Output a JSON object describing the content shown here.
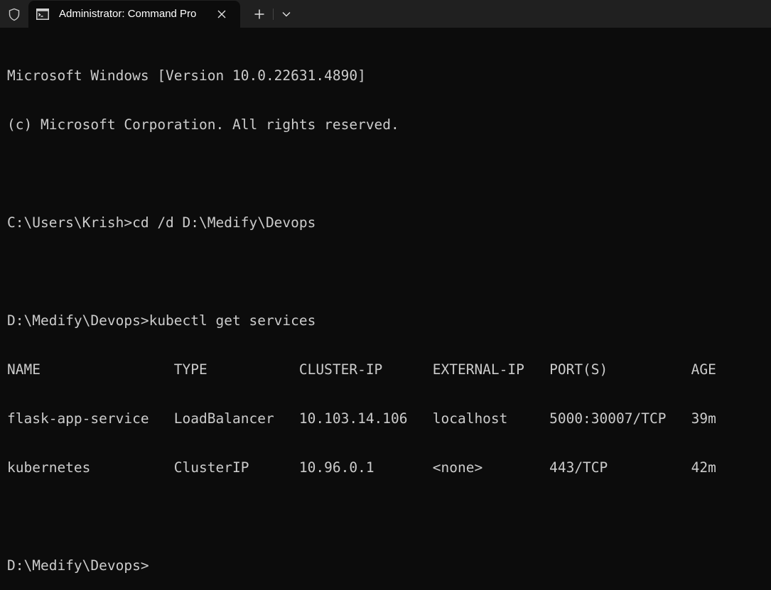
{
  "window": {
    "tab_title": "Administrator: Command Pro",
    "icons": {
      "shield": "shield-icon",
      "tab": "terminal-icon",
      "close": "close-icon",
      "new_tab": "plus-icon",
      "dropdown": "chevron-down-icon"
    }
  },
  "console": {
    "lines": [
      "Microsoft Windows [Version 10.0.22631.4890]",
      "(c) Microsoft Corporation. All rights reserved.",
      "",
      "C:\\Users\\Krish>cd /d D:\\Medify\\Devops",
      "",
      "D:\\Medify\\Devops>kubectl get services",
      "NAME                TYPE           CLUSTER-IP      EXTERNAL-IP   PORT(S)          AGE",
      "flask-app-service   LoadBalancer   10.103.14.106   localhost     5000:30007/TCP   39m",
      "kubernetes          ClusterIP      10.96.0.1       <none>        443/TCP          42m",
      "",
      "D:\\Medify\\Devops>"
    ]
  },
  "colors": {
    "background": "#0c0c0c",
    "titlebar": "#202020",
    "text": "#cccccc"
  }
}
